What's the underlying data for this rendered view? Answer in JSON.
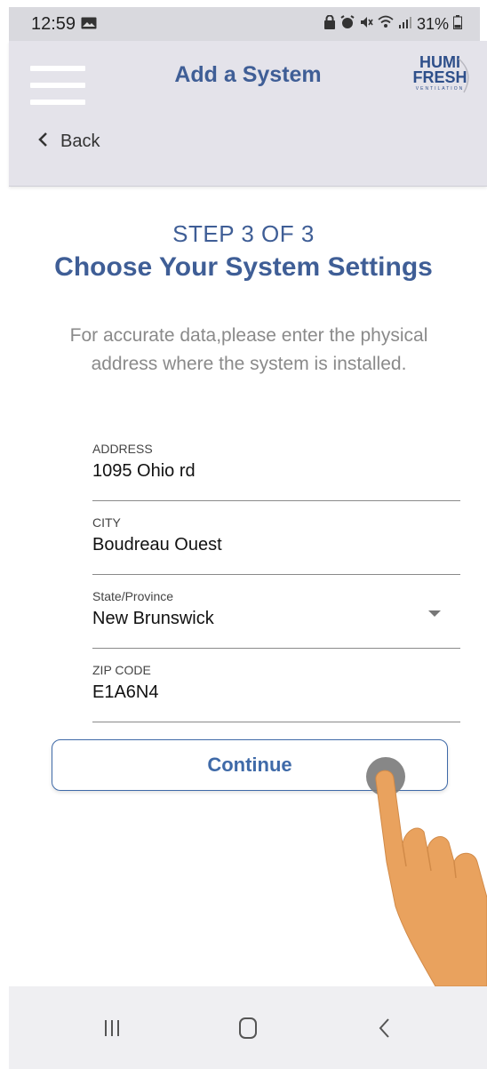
{
  "status_bar": {
    "time": "12:59",
    "battery": "31%",
    "icons": [
      "image-icon",
      "lock-icon",
      "alarm-icon",
      "mute-icon",
      "wifi-icon",
      "signal-icon",
      "battery-icon"
    ]
  },
  "header": {
    "title": "Add a System",
    "logo_line1": "HUMI",
    "logo_line2": "FRESH",
    "logo_line3": "VENTILATION",
    "back_label": "Back"
  },
  "main": {
    "step": "STEP 3 OF 3",
    "title": "Choose Your System Settings",
    "instructions": "For accurate data,please enter the physical address where the system is installed."
  },
  "form": {
    "address": {
      "label": "ADDRESS",
      "value": "1095 Ohio rd"
    },
    "city": {
      "label": "CITY",
      "value": "Boudreau Ouest"
    },
    "state": {
      "label": "State/Province",
      "value": "New Brunswick"
    },
    "zip": {
      "label": "ZIP CODE",
      "value": "E1A6N4"
    }
  },
  "continue_label": "Continue",
  "colors": {
    "brand": "#3f5e96",
    "header_bg": "#e4e3ea",
    "button_border": "#3f6aa8",
    "hand": "#e9a25e"
  }
}
